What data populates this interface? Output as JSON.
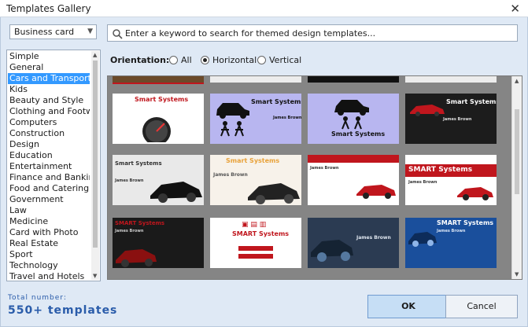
{
  "window": {
    "title": "Templates Gallery",
    "close_glyph": "✕"
  },
  "type_select": {
    "value": "Business card",
    "arrow": "▼"
  },
  "search": {
    "placeholder": "Enter a keyword to search for themed design templates...",
    "icon": "search-icon"
  },
  "categories": {
    "items": [
      "Simple",
      "General",
      "Cars and Transport",
      "Kids",
      "Beauty and Style",
      "Clothing and Footwear",
      "Computers",
      "Construction",
      "Design",
      "Education",
      "Entertainment",
      "Finance and Banking",
      "Food and Catering",
      "Government",
      "Law",
      "Medicine",
      "Card with Photo",
      "Real Estate",
      "Sport",
      "Technology",
      "Travel and Hotels"
    ],
    "selected": "Cars and Transport"
  },
  "orientation": {
    "label": "Orientation:",
    "options": [
      "All",
      "Horizontal",
      "Vertical"
    ],
    "selected": "Horizontal"
  },
  "templates": {
    "card_texts": {
      "smart_systems": "Smart Systems",
      "smart_systems_caps": "SMART Systems",
      "james_brown": "James Brown"
    },
    "colors": {
      "red": "#c0161d",
      "lavender": "#b8b6f0",
      "dark": "#1c1c1c",
      "blue": "#1a4f9c",
      "orange": "#e8a23a"
    }
  },
  "footer": {
    "total_label": "Total number:",
    "total_value": "550+ templates",
    "ok_label": "OK",
    "cancel_label": "Cancel"
  }
}
